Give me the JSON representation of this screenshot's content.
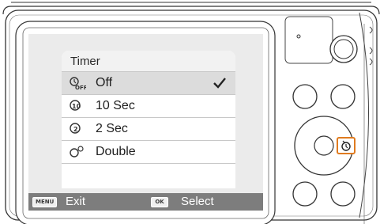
{
  "menu": {
    "title": "Timer",
    "items": [
      {
        "label": "Off",
        "icon": "timer-off-icon",
        "selected": true
      },
      {
        "label": "10 Sec",
        "icon": "timer-10-icon",
        "selected": false
      },
      {
        "label": "2 Sec",
        "icon": "timer-2-icon",
        "selected": false
      },
      {
        "label": "Double",
        "icon": "timer-double-icon",
        "selected": false
      }
    ]
  },
  "status_bar": {
    "menu_key": "MENU",
    "exit_label": "Exit",
    "ok_key": "OK",
    "select_label": "Select"
  },
  "colors": {
    "screen_bg": "#ebebeb",
    "status_bar": "#7d7d7d",
    "highlight": "#e07b1f"
  }
}
